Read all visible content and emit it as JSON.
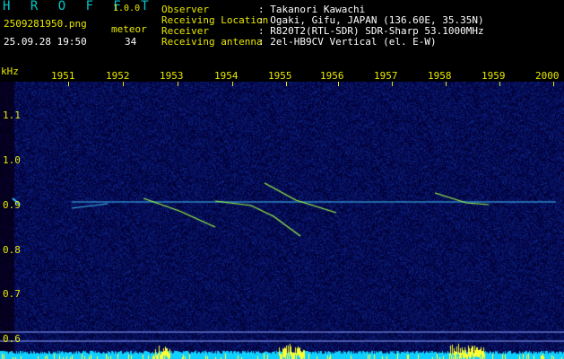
{
  "header": {
    "app_name": "H R O F F T",
    "version": "1.0.0",
    "filename": "2509281950.png",
    "datetime": "25.09.28 19:50",
    "meteor_label": "meteor",
    "meteor_count": "34",
    "info": [
      {
        "label": "Observer",
        "value": ": Takanori Kawachi"
      },
      {
        "label": "Receiving Location",
        "value": ": Ogaki, Gifu, JAPAN (136.60E, 35.35N)"
      },
      {
        "label": "Receiver",
        "value": ": R820T2(RTL-SDR) SDR-Sharp 53.1000MHz"
      },
      {
        "label": "Receiving antenna",
        "value": ": 2el-HB9CV Vertical (el. E-W)"
      }
    ]
  },
  "axes": {
    "y_unit": "kHz",
    "x_ticks": [
      "1951",
      "1952",
      "1953",
      "1954",
      "1955",
      "1956",
      "1957",
      "1958",
      "1959",
      "2000"
    ],
    "y_ticks": [
      "1.1",
      "1.0",
      "0.9",
      "0.8",
      "0.7",
      "0.6"
    ]
  },
  "colors": {
    "background": "#000000",
    "noise": "#0a1e6e",
    "carrier": "#40c0ff",
    "meteor": "#a0ff40",
    "text_cyan": "#00c8c8",
    "text_yellow": "#e8e800"
  }
}
